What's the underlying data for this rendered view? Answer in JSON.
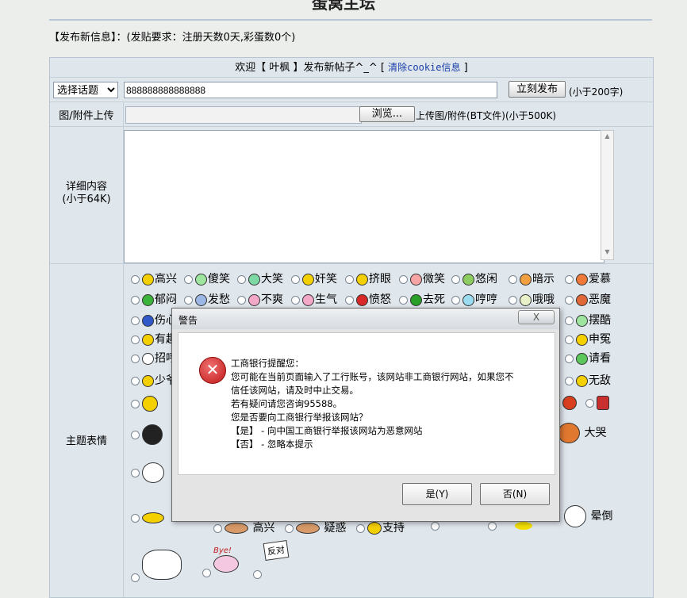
{
  "page": {
    "title": "蛋窝主坛",
    "notice": "【发布新信息】：(发贴要求：注册天数0天,彩蛋数0个)"
  },
  "header": {
    "welcome_prefix": "欢迎【 叶枫 】发布新帖子^_^ [",
    "clear_cookie": "清除cookie信息",
    "welcome_suffix": "]"
  },
  "subject_row": {
    "topic_select": "选择话题",
    "subject_value": "888888888888888",
    "publish_button": "立刻发布",
    "limit_hint": "(小于200字)"
  },
  "upload_row": {
    "label": "图/附件上传",
    "browse_button": "浏览...",
    "hint": "上传图/附件(BT文件)(小于500K)"
  },
  "content_row": {
    "label_line1": "详细内容",
    "label_line2": "(小于64K)"
  },
  "emotions": {
    "label": "主题表情",
    "row1": [
      "高兴",
      "傻笑",
      "大笑",
      "奸笑",
      "挤眼",
      "微笑",
      "悠闲",
      "暗示",
      "爱慕"
    ],
    "row2": [
      "郁闷",
      "发愁",
      "不爽",
      "生气",
      "愤怒",
      "去死",
      "哼哼",
      "哦哦",
      "恶魔"
    ],
    "row3_left": "伤心",
    "row3_right": "摆酷",
    "row4_left": "有趣",
    "row4_right": "申冤",
    "row5_left": "招呼",
    "row5_right": "请看",
    "row6_left": "少爷",
    "row6_right": "无敌",
    "big_labels": [
      "大哭",
      "高兴",
      "疑惑",
      "支持",
      "晕倒"
    ],
    "bye_text": "Bye!",
    "sign_text": "反对"
  },
  "dialog": {
    "title": "警告",
    "close": "X",
    "lines": [
      "工商银行提醒您：",
      "您可能在当前页面输入了工行账号，该网站非工商银行网站，如果您不",
      "信任该网站，请及时中止交易。",
      "若有疑问请您咨询95588。",
      "您是否要向工商银行举报该网站？",
      "【是】  -  向中国工商银行举报该网站为恶意网站",
      "【否】  -  忽略本提示"
    ],
    "yes_button": "是(Y)",
    "no_button": "否(N)"
  },
  "colors": {
    "link": "#1a3fa8",
    "form_bg": "#dfe6ec",
    "error_red": "#c01818"
  }
}
